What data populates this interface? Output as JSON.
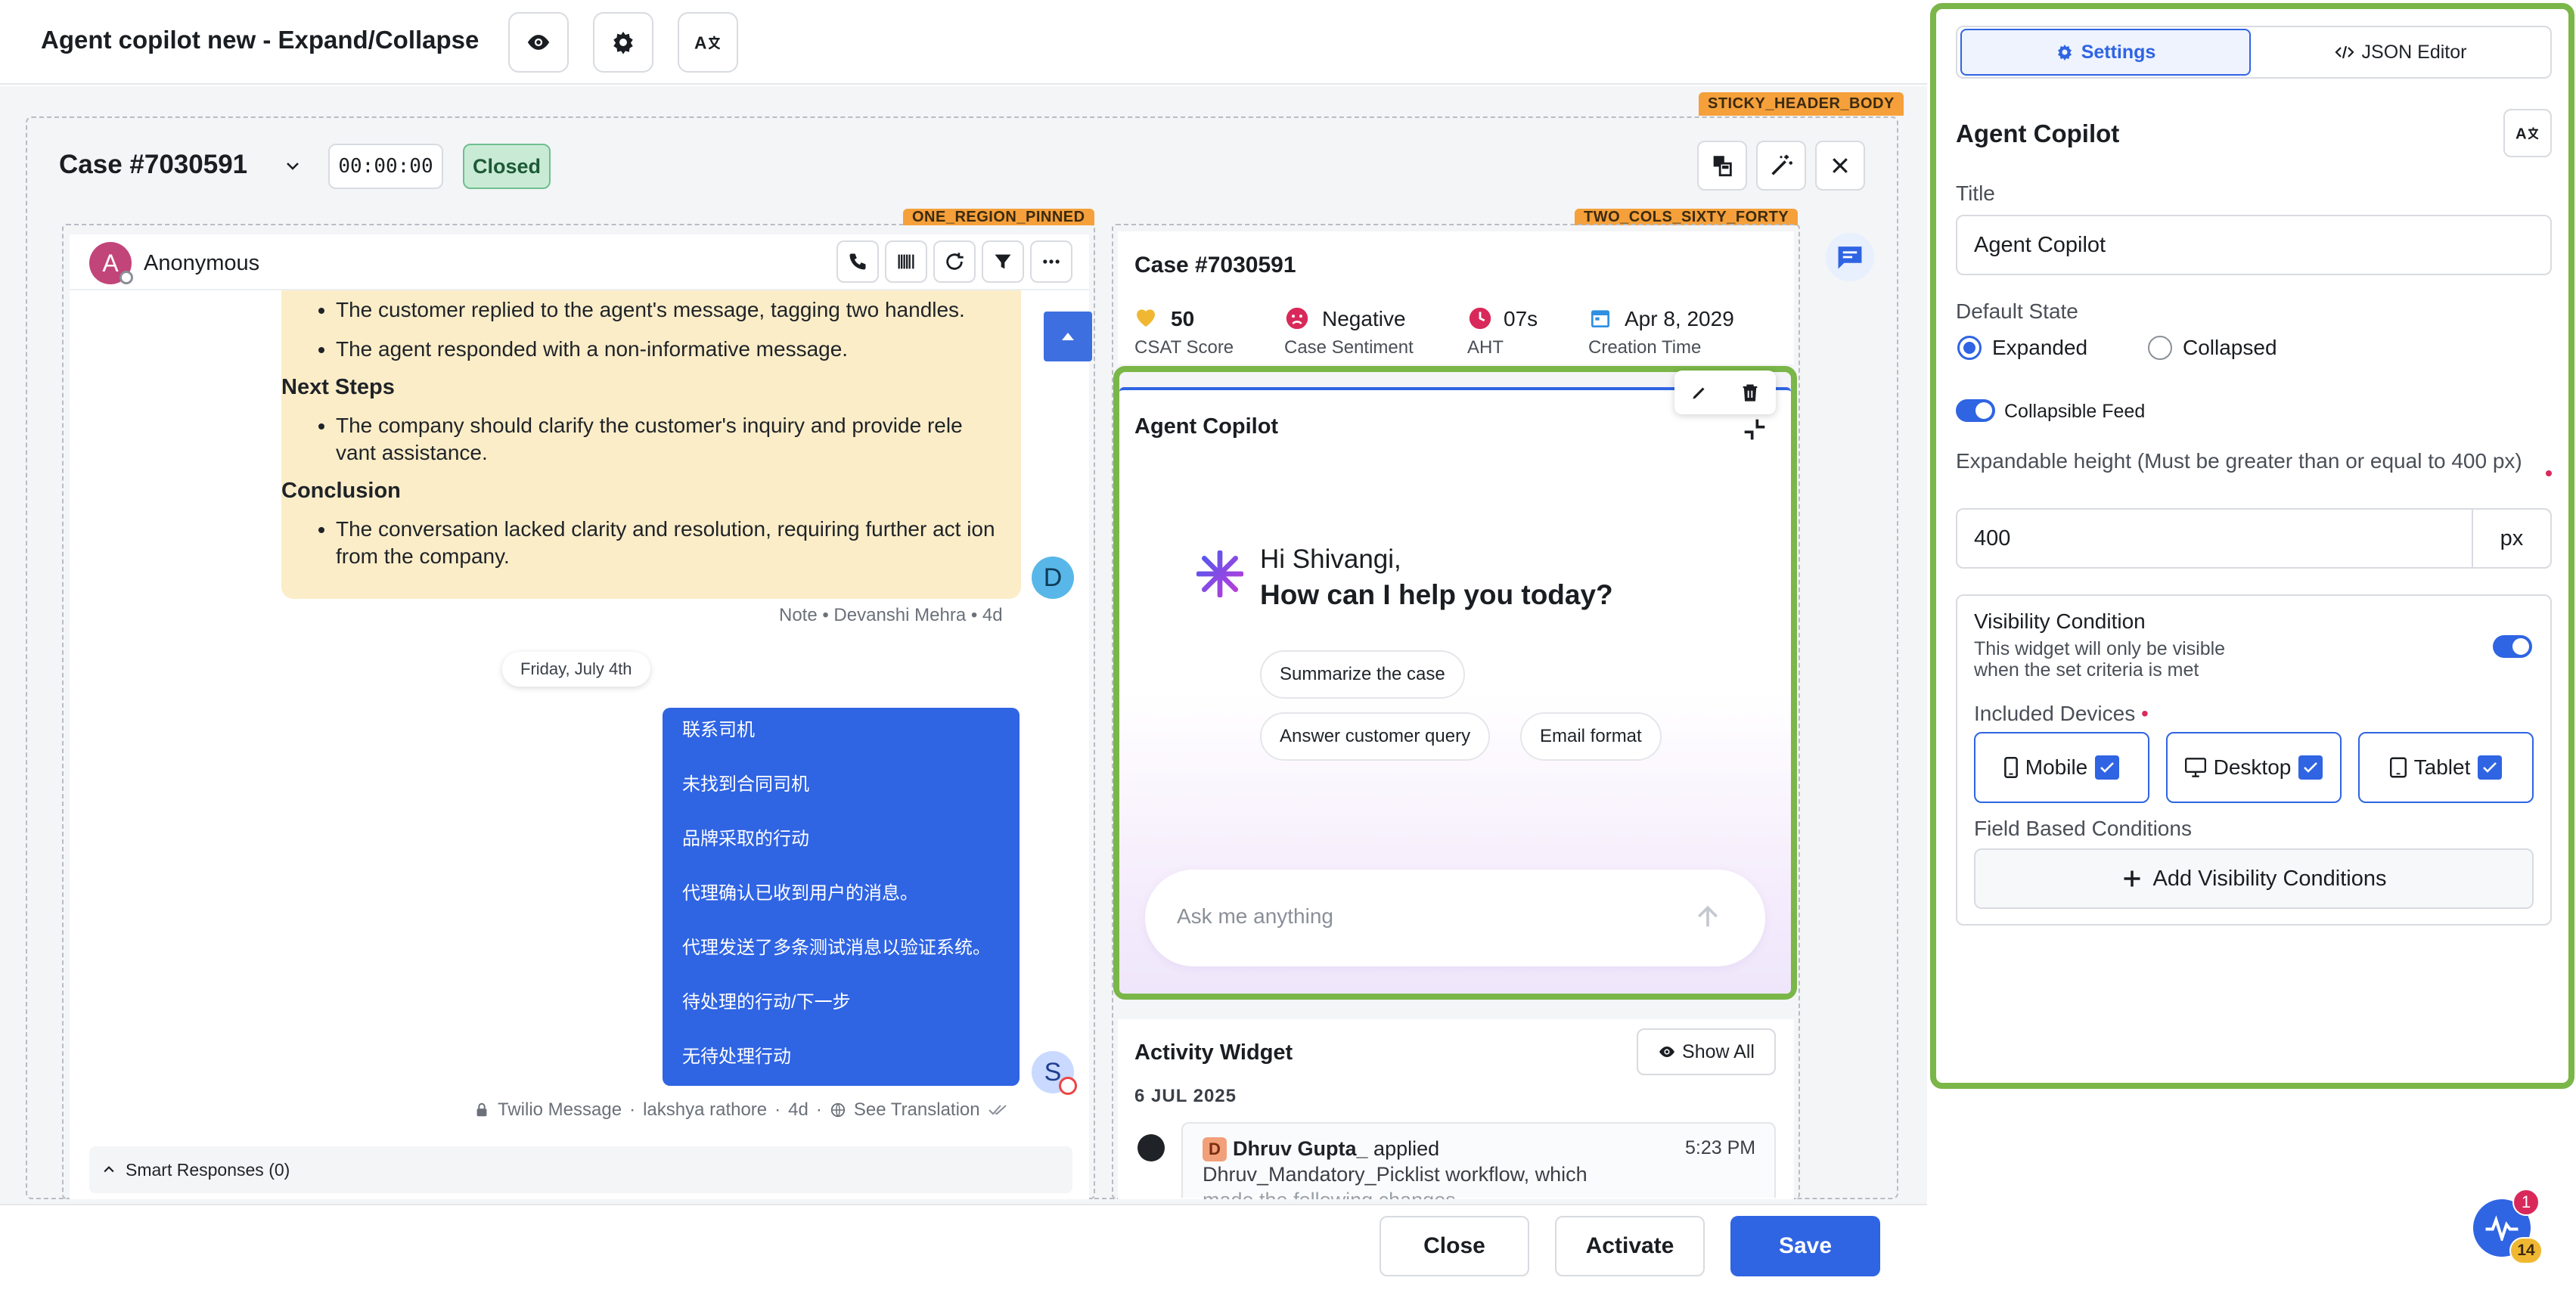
{
  "app": {
    "title": "Agent copilot new - Expand/Collapse"
  },
  "icons": {
    "preview": "eye-icon",
    "settings": "gear-icon",
    "translate": "translate-icon"
  },
  "regions": {
    "sticky_header": "STICKY_HEADER_BODY",
    "one_region": "ONE_REGION_PINNED",
    "two_region": "TWO_COLS_SIXTY_FORTY"
  },
  "case_header": {
    "title": "Case #7030591",
    "timer": "00:00:00",
    "status": "Closed"
  },
  "conversation": {
    "contact_avatar": "A",
    "contact_name": "Anonymous",
    "note": {
      "bullets_top": [
        "The customer replied to the agent's message, tagging two handles.",
        "The agent responded with a non-informative message."
      ],
      "next_steps_heading": "Next Steps",
      "next_steps": [
        "The company should clarify the customer's inquiry and provide rele vant assistance."
      ],
      "conclusion_heading": "Conclusion",
      "conclusion": [
        "The conversation lacked clarity and resolution, requiring further act ion from the company."
      ],
      "avatar": "D",
      "meta": "Note • Devanshi Mehra • 4d"
    },
    "date_chip": "Friday, July 4th",
    "message": {
      "lines": [
        "联系司机",
        "未找到合同司机",
        "品牌采取的行动",
        "代理确认已收到用户的消息。",
        "代理发送了多条测试消息以验证系统。",
        "待处理的行动/下一步",
        "无待处理行动"
      ],
      "avatar": "S",
      "channel": "Twilio Message",
      "author": "lakshya rathore",
      "age": "4d",
      "translation": "See Translation"
    },
    "smart_responses": "Smart Responses (0)"
  },
  "case_card": {
    "title": "Case #7030591",
    "metrics": [
      {
        "value": "50",
        "label": "CSAT Score",
        "color": "#f0b832"
      },
      {
        "value": "Negative",
        "label": "Case Sentiment",
        "color": "#d8295a"
      },
      {
        "value": "07s",
        "label": "AHT",
        "color": "#d8295a"
      },
      {
        "value": "Apr 8, 2029",
        "label": "Creation Time",
        "color": "#2f8fe0"
      }
    ]
  },
  "copilot": {
    "title": "Agent Copilot",
    "greeting_line1": "Hi Shivangi,",
    "greeting_line2": "How can I help you today?",
    "suggestions": [
      "Summarize the case",
      "Answer customer query",
      "Email format"
    ],
    "input_placeholder": "Ask me anything"
  },
  "activity": {
    "title": "Activity Widget",
    "show_all": "Show All",
    "date": "6 JUL 2025",
    "entry": {
      "avatar": "D",
      "user": "Dhruv Gupta_",
      "action": "applied",
      "time": "5:23 PM",
      "line2": "Dhruv_Mandatory_Picklist workflow, which",
      "line3": "made the following changes"
    }
  },
  "footer": {
    "close": "Close",
    "activate": "Activate",
    "save": "Save"
  },
  "settings": {
    "tab_settings": "Settings",
    "tab_json": "JSON Editor",
    "panel_title": "Agent Copilot",
    "title_label": "Title",
    "title_value": "Agent Copilot",
    "default_state_label": "Default State",
    "state_expanded": "Expanded",
    "state_collapsed": "Collapsed",
    "collapsible_feed": "Collapsible Feed",
    "height_label": "Expandable height (Must be greater than or equal to 400 px)",
    "height_value": "400",
    "height_unit": "px",
    "visibility_title": "Visibility Condition",
    "visibility_desc": "This widget will only be visible when the set criteria is met",
    "included_devices": "Included Devices",
    "devices": [
      "Mobile",
      "Desktop",
      "Tablet"
    ],
    "field_conditions": "Field Based Conditions",
    "add_visibility": "Add Visibility Conditions"
  },
  "notifications": {
    "badge_red": "1",
    "badge_yellow": "14"
  },
  "colors": {
    "accent": "#2f64e3",
    "highlight_border": "#7ab648",
    "note_bg": "#fbedc8",
    "region_tag": "#f5a03a"
  }
}
